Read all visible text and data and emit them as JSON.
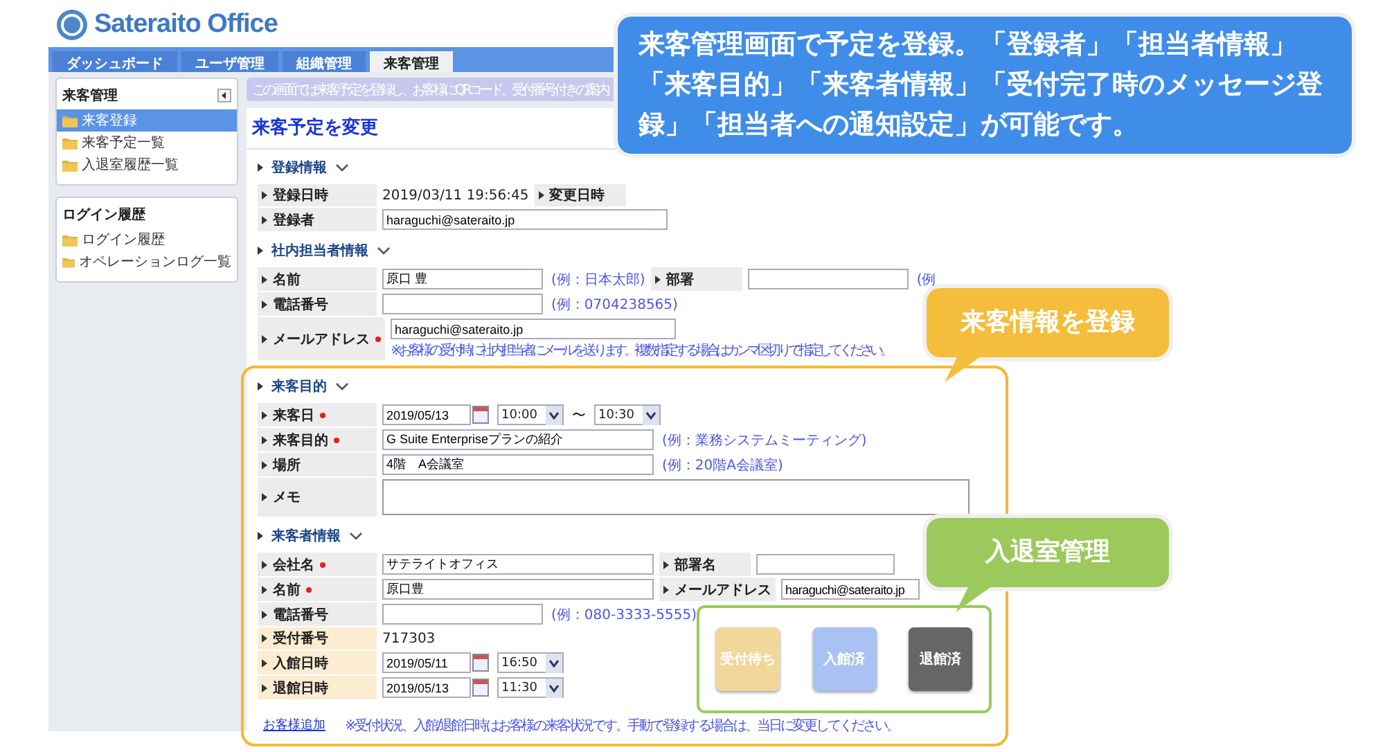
{
  "logo": {
    "text": "Sateraito Office"
  },
  "tabs": [
    {
      "label": "ダッシュボード",
      "selected": false
    },
    {
      "label": "ユーザ管理",
      "selected": false
    },
    {
      "label": "組織管理",
      "selected": false
    },
    {
      "label": "来客管理",
      "selected": true
    }
  ],
  "sidebar": {
    "panels": [
      {
        "title": "来客管理",
        "collapsible": true,
        "items": [
          {
            "label": "来客登録",
            "selected": true
          },
          {
            "label": "来客予定一覧",
            "selected": false
          },
          {
            "label": "入退室履歴一覧",
            "selected": false
          }
        ]
      },
      {
        "title": "ログイン履歴",
        "collapsible": false,
        "items": [
          {
            "label": "ログイン履歴",
            "selected": false
          },
          {
            "label": "オペレーションログ一覧",
            "selected": false
          }
        ]
      }
    ]
  },
  "banner": "この画面では来客予定を登録し、お客様にQRコード、受付番号付きの案内",
  "page_title": "来客予定を変更",
  "sections": [
    {
      "title": "登録情報",
      "rows": [
        [
          {
            "label": "登録日時",
            "required": false,
            "kind": "text",
            "value": "2019/03/11 19:56:45"
          },
          {
            "label": "変更日時",
            "required": false,
            "kind": "none"
          }
        ],
        [
          {
            "label": "登録者",
            "required": false,
            "kind": "input_medium",
            "value": "haraguchi@sateraito.jp"
          }
        ]
      ]
    },
    {
      "title": "社内担当者情報",
      "rows": [
        [
          {
            "label": "名前",
            "required": false,
            "kind": "input_short",
            "value": "原口 豊",
            "hint": "(例：日本太郎)"
          },
          {
            "label": "部署",
            "required": false,
            "kind": "input_short",
            "hint": "(例"
          }
        ],
        [
          {
            "label": "電話番号",
            "required": false,
            "kind": "input_short",
            "hint": "(例：0704238565)"
          }
        ],
        [
          {
            "label": "メールアドレス",
            "required": true,
            "kind": "input_medium",
            "value": "haraguchi@sateraito.jp",
            "note": "※お客様の受付時に社内担当者にメールを送ります。複数指定する場合はカンマ区切りで指定してください。"
          }
        ]
      ]
    }
  ],
  "highlighted_sections": [
    {
      "title": "来客目的",
      "rows": [
        [
          {
            "label": "来客日",
            "required": true,
            "kind": "schedule",
            "date": "2019/05/13",
            "start": "10:00",
            "separator": "〜",
            "end": "10:30"
          }
        ],
        [
          {
            "label": "来客目的",
            "required": true,
            "kind": "input_long",
            "value": "G Suite Enterpriseプランの紹介",
            "hint": "(例：業務システムミーティング)"
          }
        ],
        [
          {
            "label": "場所",
            "required": false,
            "kind": "input_long",
            "value": "4階　A会議室",
            "hint": "(例：20階A会議室)"
          }
        ],
        [
          {
            "label": "メモ",
            "required": false,
            "kind": "textarea"
          }
        ]
      ]
    },
    {
      "title": "来客者情報",
      "rows": [
        [
          {
            "label": "会社名",
            "required": true,
            "kind": "input_long",
            "value": "サテライトオフィス"
          },
          {
            "label": "部署名",
            "required": false,
            "kind": "input_partial"
          }
        ],
        [
          {
            "label": "名前",
            "required": true,
            "kind": "input_long",
            "value": "原口豊"
          },
          {
            "label": "メールアドレス",
            "required": false,
            "kind": "input_partial",
            "value": "haraguchi@sateraito.jp"
          }
        ]
      ],
      "lower_rows": [
        [
          {
            "label": "電話番号",
            "required": false,
            "kind": "input_short",
            "hint": "(例：080-3333-5555)"
          }
        ],
        [
          {
            "label": "受付番号",
            "required": false,
            "highlighted": true,
            "kind": "text",
            "value": "717303"
          }
        ],
        [
          {
            "label": "入館日時",
            "required": false,
            "highlighted": true,
            "kind": "datetime",
            "date": "2019/05/11",
            "time": "16:50"
          }
        ],
        [
          {
            "label": "退館日時",
            "required": false,
            "highlighted": true,
            "kind": "datetime",
            "date": "2019/05/13",
            "time": "11:30"
          }
        ]
      ],
      "status_buttons": [
        {
          "label": "受付待ち",
          "color": "#f2d79a"
        },
        {
          "label": "入館済",
          "color": "#a9c2f3"
        },
        {
          "label": "退館済",
          "color": "#666666"
        }
      ]
    }
  ],
  "footer": {
    "link": "お客様追加",
    "note": "※受付状況、入館/退館日時はお客様の来客状況です。手動で登録する場合は、当日に変更してください。"
  },
  "callouts": [
    {
      "kind": "headline",
      "text": "来客管理画面で予定を登録。「登録者」「担当者情報」「来客目的」「来客者情報」「受付完了時のメッセージ登録」「担当者への通知設定」が可能です。",
      "color": "#3f8de8"
    },
    {
      "kind": "visitor",
      "text": "来客情報を登録",
      "color": "#f5bd3c"
    },
    {
      "kind": "room",
      "text": "入退室管理",
      "color": "#9cc95c"
    }
  ]
}
